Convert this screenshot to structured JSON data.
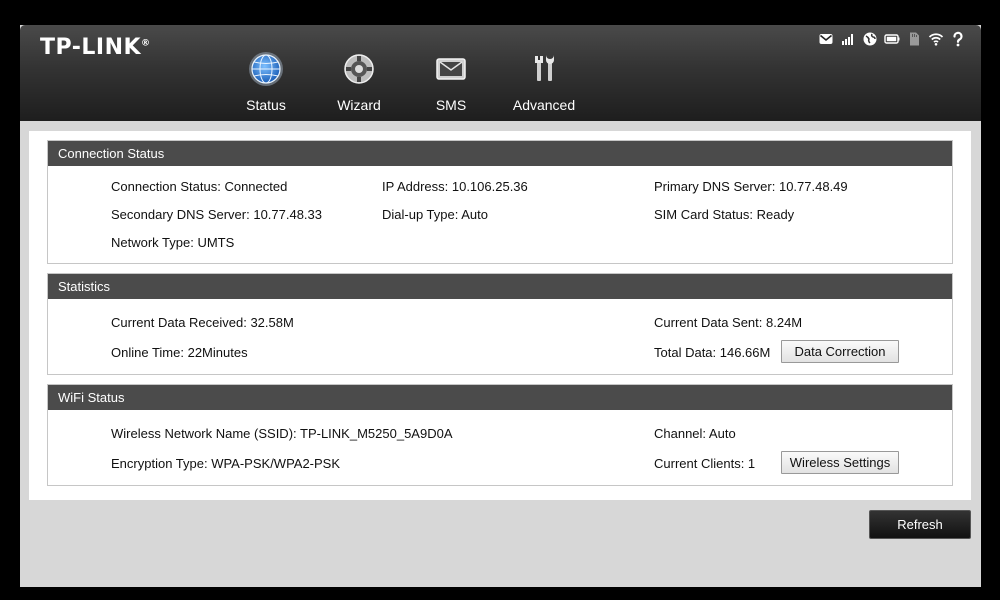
{
  "brand": {
    "logo_text": "TP-LINK",
    "registered": "®"
  },
  "nav": {
    "items": [
      {
        "label": "Status",
        "icon": "globe-icon"
      },
      {
        "label": "Wizard",
        "icon": "gear-icon"
      },
      {
        "label": "SMS",
        "icon": "envelope-icon"
      },
      {
        "label": "Advanced",
        "icon": "tools-icon"
      }
    ],
    "active": "Status"
  },
  "status_bar": {
    "icons": [
      "mail-icon",
      "signal-icon",
      "globe-icon",
      "battery-icon",
      "sd-card-icon",
      "wifi-icon",
      "help-icon"
    ]
  },
  "connection": {
    "title": "Connection Status",
    "connection_status": "Connection Status: Connected",
    "ip_address": "IP Address: 10.106.25.36",
    "primary_dns": "Primary DNS Server: 10.77.48.49",
    "secondary_dns": "Secondary DNS Server: 10.77.48.33",
    "dialup_type": "Dial-up Type: Auto",
    "sim_status": "SIM Card Status: Ready",
    "network_type": "Network Type: UMTS"
  },
  "statistics": {
    "title": "Statistics",
    "data_received": "Current Data Received: 32.58M",
    "data_sent": "Current Data Sent: 8.24M",
    "online_time": "Online Time: 22Minutes",
    "total_data": "Total Data: 146.66M",
    "data_correction_label": "Data Correction"
  },
  "wifi": {
    "title": "WiFi Status",
    "ssid": "Wireless Network Name (SSID): TP-LINK_M5250_5A9D0A",
    "channel": "Channel: Auto",
    "encryption": "Encryption Type: WPA-PSK/WPA2-PSK",
    "clients": "Current Clients: 1",
    "wireless_settings_label": "Wireless Settings"
  },
  "refresh_label": "Refresh",
  "colors": {
    "header_dark": "#1e1e1e",
    "section_header": "#4b4b4b",
    "accent_blue": "#2f7fd6",
    "background": "#d7d7d7"
  }
}
